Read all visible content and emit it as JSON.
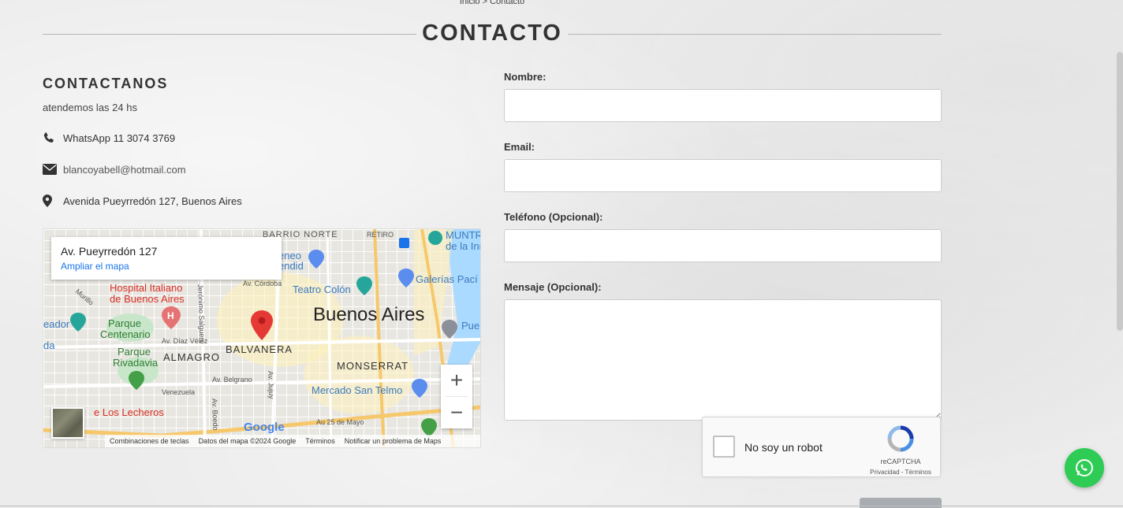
{
  "breadcrumb": {
    "home": "Inicio",
    "separator": ">",
    "current": "Contacto"
  },
  "page_title": "CONTACTO",
  "contact": {
    "heading": "CONTACTANOS",
    "hours": "atendemos las 24 hs",
    "phone": "WhatsApp 11 3074 3769",
    "email": "blancoyabell@hotmail.com",
    "address": "Avenida Pueyrredón 127, Buenos Aires"
  },
  "map": {
    "card_address": "Av. Pueyrredón 127",
    "card_link": "Ampliar el mapa",
    "zoom_in": "+",
    "zoom_out": "−",
    "google": "Google",
    "footer": {
      "shortcuts": "Combinaciones de teclas",
      "data": "Datos del mapa ©2024 Google",
      "terms": "Términos",
      "report": "Notificar un problema de Maps"
    },
    "labels": {
      "barrio_norte": "BARRIO NORTE",
      "retiro": "RETIRO",
      "hospital1": "Hospital Italiano",
      "hospital2": "de Buenos Aires",
      "teatro": "Teatro Colón",
      "buenos_aires": "Buenos Aires",
      "parque_centenario1": "Parque",
      "parque_centenario2": "Centenario",
      "parque_rivadavia1": "Parque",
      "parque_rivadavia2": "Rivadavia",
      "almagro": "ALMAGRO",
      "balvanera": "BALVANERA",
      "monserrat": "MONSERRAT",
      "mercado": "Mercado San Telmo",
      "lecheros": "e Los Lecheros",
      "galerias": "Galerías Pací",
      "muntref1": "MUNTR",
      "muntref2": "de la Inm",
      "geneo1": "eneo",
      "geneo2": "endid",
      "av_cordoba": "Av. Córdoba",
      "av_diaz_velez": "Av. Díaz Vélez",
      "av_belgrano": "Av. Belgrano",
      "av_25_mayo": "Au 25 de Mayo",
      "venezuela": "Venezuela",
      "av_boedo": "Av. Boedo",
      "av_jujuy": "Av. Jujuy",
      "murillo": "Murillo",
      "jeronimo": "Jerónimo Salguero",
      "eador": "eador",
      "da": "da",
      "pue": "Pue"
    }
  },
  "form": {
    "name_label": "Nombre:",
    "email_label": "Email:",
    "phone_label": "Teléfono (Opcional):",
    "message_label": "Mensaje (Opcional):"
  },
  "recaptcha": {
    "label": "No soy un robot",
    "brand": "reCAPTCHA",
    "links": "Privacidad - Términos"
  },
  "colors": {
    "whatsapp": "#2ecc54",
    "link": "#1a73e8",
    "pin": "#e53935"
  }
}
